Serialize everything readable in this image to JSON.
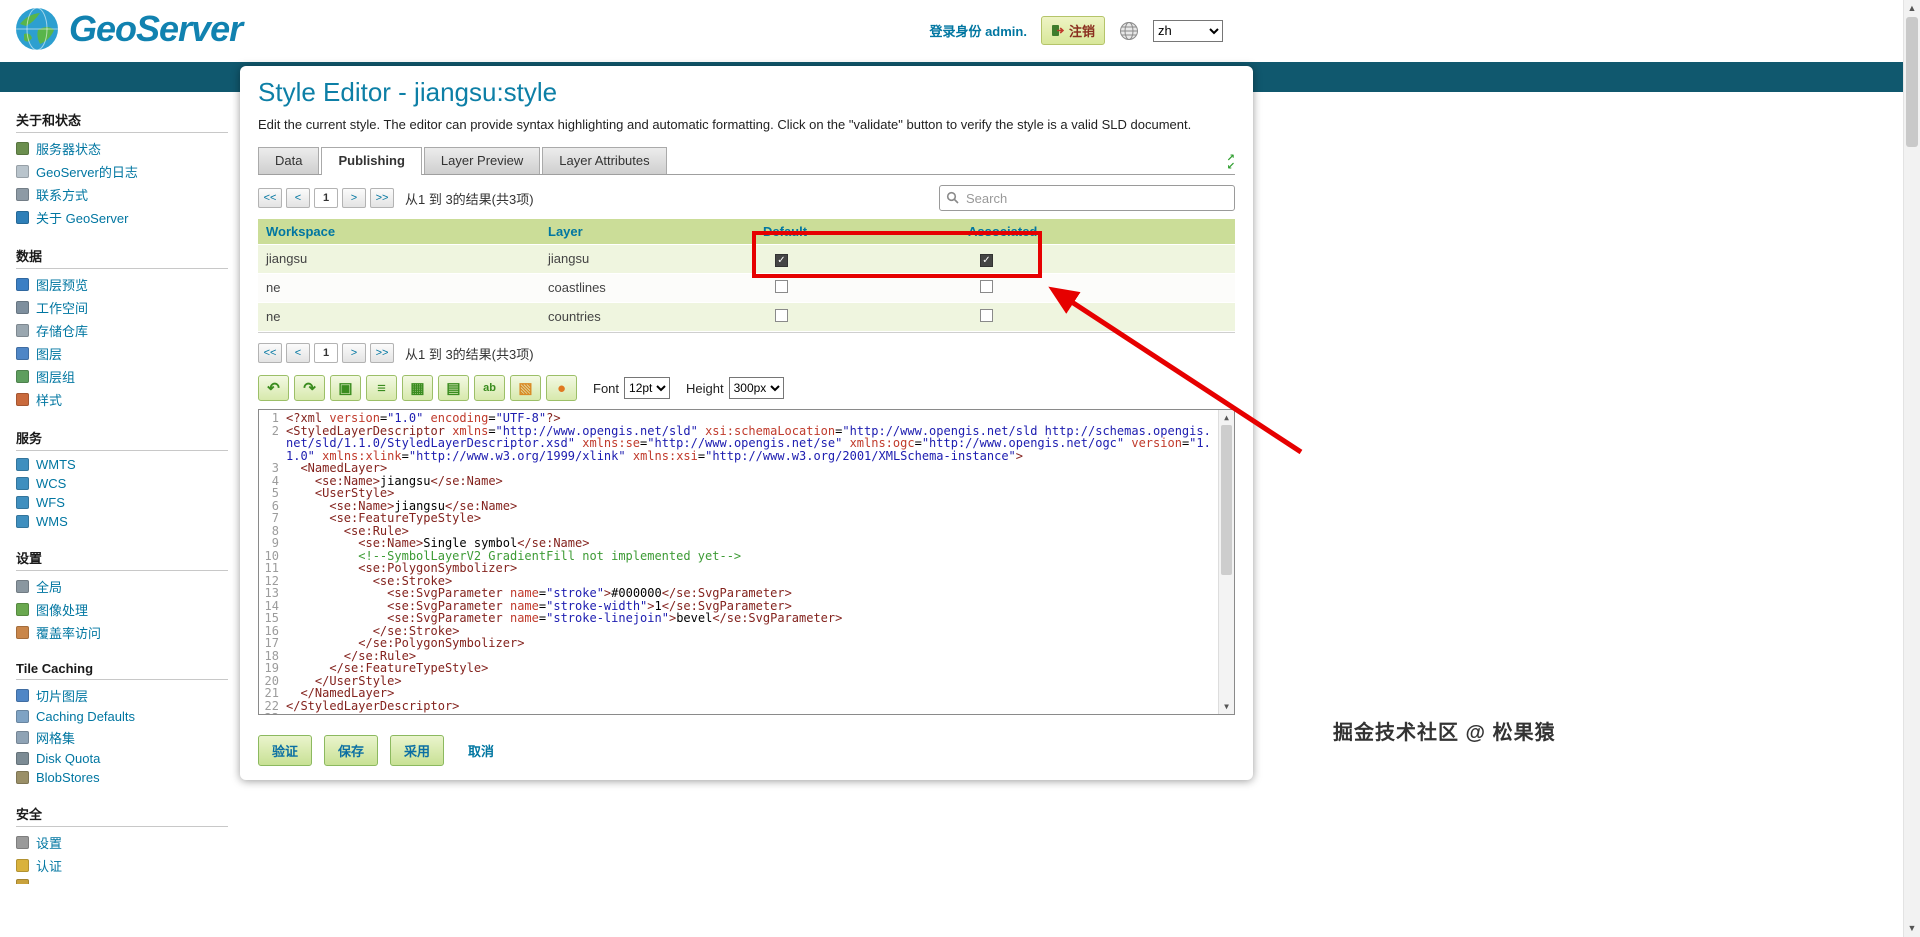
{
  "header": {
    "logo_text": "GeoServer",
    "login_status": "登录身份 admin.",
    "logout_label": "注销",
    "language": "zh"
  },
  "sidebar": {
    "sections": [
      {
        "title": "关于和状态",
        "items": [
          {
            "label": "服务器状态",
            "icon": "server-status-icon",
            "color": "#6b8e4e"
          },
          {
            "label": "GeoServer的日志",
            "icon": "logs-icon",
            "color": "#b9c4cc"
          },
          {
            "label": "联系方式",
            "icon": "contact-icon",
            "color": "#8d9aa5"
          },
          {
            "label": "关于 GeoServer",
            "icon": "about-geoserver-icon",
            "color": "#2e7fb8"
          }
        ]
      },
      {
        "title": "数据",
        "items": [
          {
            "label": "图层预览",
            "icon": "layer-preview-icon",
            "color": "#3b7fc4"
          },
          {
            "label": "工作空间",
            "icon": "workspaces-icon",
            "color": "#7e8f9e"
          },
          {
            "label": "存储仓库",
            "icon": "stores-icon",
            "color": "#9aa7b0"
          },
          {
            "label": "图层",
            "icon": "layers-icon",
            "color": "#4f86c6"
          },
          {
            "label": "图层组",
            "icon": "layer-groups-icon",
            "color": "#5e9e5e"
          },
          {
            "label": "样式",
            "icon": "styles-icon",
            "color": "#c96a3d"
          }
        ]
      },
      {
        "title": "服务",
        "items": [
          {
            "label": "WMTS",
            "icon": "wmts-service-icon",
            "color": "#3f8fbf"
          },
          {
            "label": "WCS",
            "icon": "wcs-service-icon",
            "color": "#3f8fbf"
          },
          {
            "label": "WFS",
            "icon": "wfs-service-icon",
            "color": "#3f8fbf"
          },
          {
            "label": "WMS",
            "icon": "wms-service-icon",
            "color": "#3f8fbf"
          }
        ]
      },
      {
        "title": "设置",
        "items": [
          {
            "label": "全局",
            "icon": "global-settings-icon",
            "color": "#8a97a0"
          },
          {
            "label": "图像处理",
            "icon": "image-processing-icon",
            "color": "#6aa84f"
          },
          {
            "label": "覆盖率访问",
            "icon": "coverage-access-icon",
            "color": "#c9864a"
          }
        ]
      },
      {
        "title": "Tile Caching",
        "items": [
          {
            "label": "切片图层",
            "icon": "tile-layers-icon",
            "color": "#4f86c6"
          },
          {
            "label": "Caching Defaults",
            "icon": "caching-defaults-icon",
            "color": "#7fa3c4"
          },
          {
            "label": "网格集",
            "icon": "gridsets-icon",
            "color": "#8fa3b5"
          },
          {
            "label": "Disk Quota",
            "icon": "disk-quota-icon",
            "color": "#7c8b94"
          },
          {
            "label": "BlobStores",
            "icon": "blobstores-icon",
            "color": "#9a8f67"
          }
        ]
      },
      {
        "title": "安全",
        "items": [
          {
            "label": "设置",
            "icon": "security-settings-icon",
            "color": "#9a9a9a"
          },
          {
            "label": "认证",
            "icon": "authentication-icon",
            "color": "#d9b23c"
          },
          {
            "label": "",
            "icon": "next-item-partial-icon",
            "color": "#c9a23c"
          }
        ]
      }
    ]
  },
  "main": {
    "title": "Style Editor - jiangsu:style",
    "description": "Edit the current style. The editor can provide syntax highlighting and automatic formatting. Click on the \"validate\" button to verify the style is a valid SLD document.",
    "tabs": [
      {
        "label": "Data",
        "active": false
      },
      {
        "label": "Publishing",
        "active": true
      },
      {
        "label": "Layer Preview",
        "active": false
      },
      {
        "label": "Layer Attributes",
        "active": false
      }
    ],
    "pagination": {
      "first": "<<",
      "prev": "<",
      "page": "1",
      "next": ">",
      "last": ">>",
      "results": "从1 到 3的结果(共3项)"
    },
    "search_placeholder": "Search",
    "table": {
      "headers": [
        "Workspace",
        "Layer",
        "Default",
        "Associated"
      ],
      "rows": [
        {
          "workspace": "jiangsu",
          "layer": "jiangsu",
          "default": true,
          "associated": true
        },
        {
          "workspace": "ne",
          "layer": "coastlines",
          "default": false,
          "associated": false
        },
        {
          "workspace": "ne",
          "layer": "countries",
          "default": false,
          "associated": false
        }
      ]
    },
    "editor": {
      "toolbar": [
        {
          "name": "undo-icon",
          "glyph": "↶",
          "color": "#3a8c1f"
        },
        {
          "name": "redo-icon",
          "glyph": "↷",
          "color": "#3a8c1f"
        },
        {
          "name": "insert-image-icon",
          "glyph": "▣",
          "color": "#3a8c1f"
        },
        {
          "name": "format-lines-icon",
          "glyph": "≡",
          "color": "#3a8c1f"
        },
        {
          "name": "grid-icon",
          "glyph": "▦",
          "color": "#3a8c1f"
        },
        {
          "name": "archive-icon",
          "glyph": "▤",
          "color": "#3a8c1f"
        },
        {
          "name": "spellcheck-icon",
          "glyph": "ab",
          "color": "#3a8c1f"
        },
        {
          "name": "picture-icon",
          "glyph": "▧",
          "color": "#d98a25"
        },
        {
          "name": "preview-sphere-icon",
          "glyph": "●",
          "color": "#e07820"
        }
      ],
      "font_label": "Font",
      "font_value": "12pt",
      "height_label": "Height",
      "height_value": "300px",
      "code_lines": [
        "<?xml version=\"1.0\" encoding=\"UTF-8\"?>",
        "<StyledLayerDescriptor xmlns=\"http://www.opengis.net/sld\" xsi:schemaLocation=\"http://www.opengis.net/sld http://schemas.opengis.net/sld/1.1.0/StyledLayerDescriptor.xsd\" xmlns:se=\"http://www.opengis.net/se\" xmlns:ogc=\"http://www.opengis.net/ogc\" version=\"1.1.0\" xmlns:xlink=\"http://www.w3.org/1999/xlink\" xmlns:xsi=\"http://www.w3.org/2001/XMLSchema-instance\">",
        "  <NamedLayer>",
        "    <se:Name>jiangsu</se:Name>",
        "    <UserStyle>",
        "      <se:Name>jiangsu</se:Name>",
        "      <se:FeatureTypeStyle>",
        "        <se:Rule>",
        "          <se:Name>Single symbol</se:Name>",
        "          <!--SymbolLayerV2 GradientFill not implemented yet-->",
        "          <se:PolygonSymbolizer>",
        "            <se:Stroke>",
        "              <se:SvgParameter name=\"stroke\">#000000</se:SvgParameter>",
        "              <se:SvgParameter name=\"stroke-width\">1</se:SvgParameter>",
        "              <se:SvgParameter name=\"stroke-linejoin\">bevel</se:SvgParameter>",
        "            </se:Stroke>",
        "          </se:PolygonSymbolizer>",
        "        </se:Rule>",
        "      </se:FeatureTypeStyle>",
        "    </UserStyle>",
        "  </NamedLayer>",
        "</StyledLayerDescriptor>",
        ""
      ]
    },
    "actions": {
      "validate": "验证",
      "save": "保存",
      "apply": "采用",
      "cancel": "取消"
    }
  },
  "annotation": {
    "color": "#e60000"
  },
  "watermark": "掘金技术社区 @ 松果猿"
}
